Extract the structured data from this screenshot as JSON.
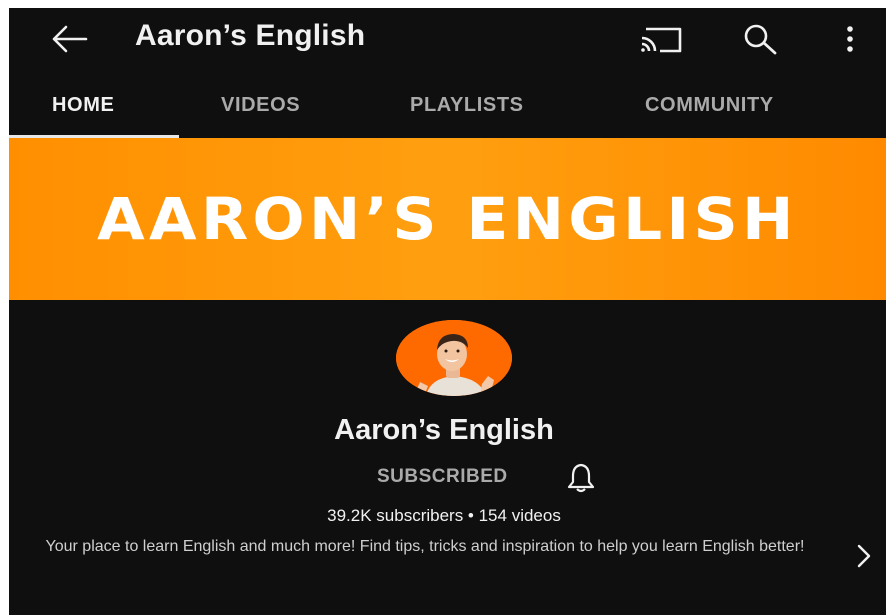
{
  "app": {
    "title": "Aaron’s English"
  },
  "topbar": {
    "back_icon": "arrow-left-icon",
    "cast_icon": "cast-icon",
    "search_icon": "search-icon",
    "more_icon": "more-vertical-icon"
  },
  "tabs": [
    {
      "label": "HOME",
      "active": true
    },
    {
      "label": "VIDEOS",
      "active": false
    },
    {
      "label": "PLAYLISTS",
      "active": false
    },
    {
      "label": "COMMUNITY",
      "active": false
    }
  ],
  "banner": {
    "text": "AARON’S ENGLISH",
    "color": "#ff9200"
  },
  "channel": {
    "name": "Aaron’s English",
    "subscribe_status": "SUBSCRIBED",
    "bell_icon": "bell-icon",
    "stats": "39.2K subscribers • 154 videos",
    "description": "Your place to learn English and much more! Find tips, tricks and inspiration to help you learn English better!",
    "expand_icon": "chevron-right-icon",
    "avatar_color": "#ff6a00"
  },
  "colors": {
    "background": "#0f0f0f",
    "text_primary": "#f1f1f1",
    "text_secondary": "#aaaaaa"
  }
}
